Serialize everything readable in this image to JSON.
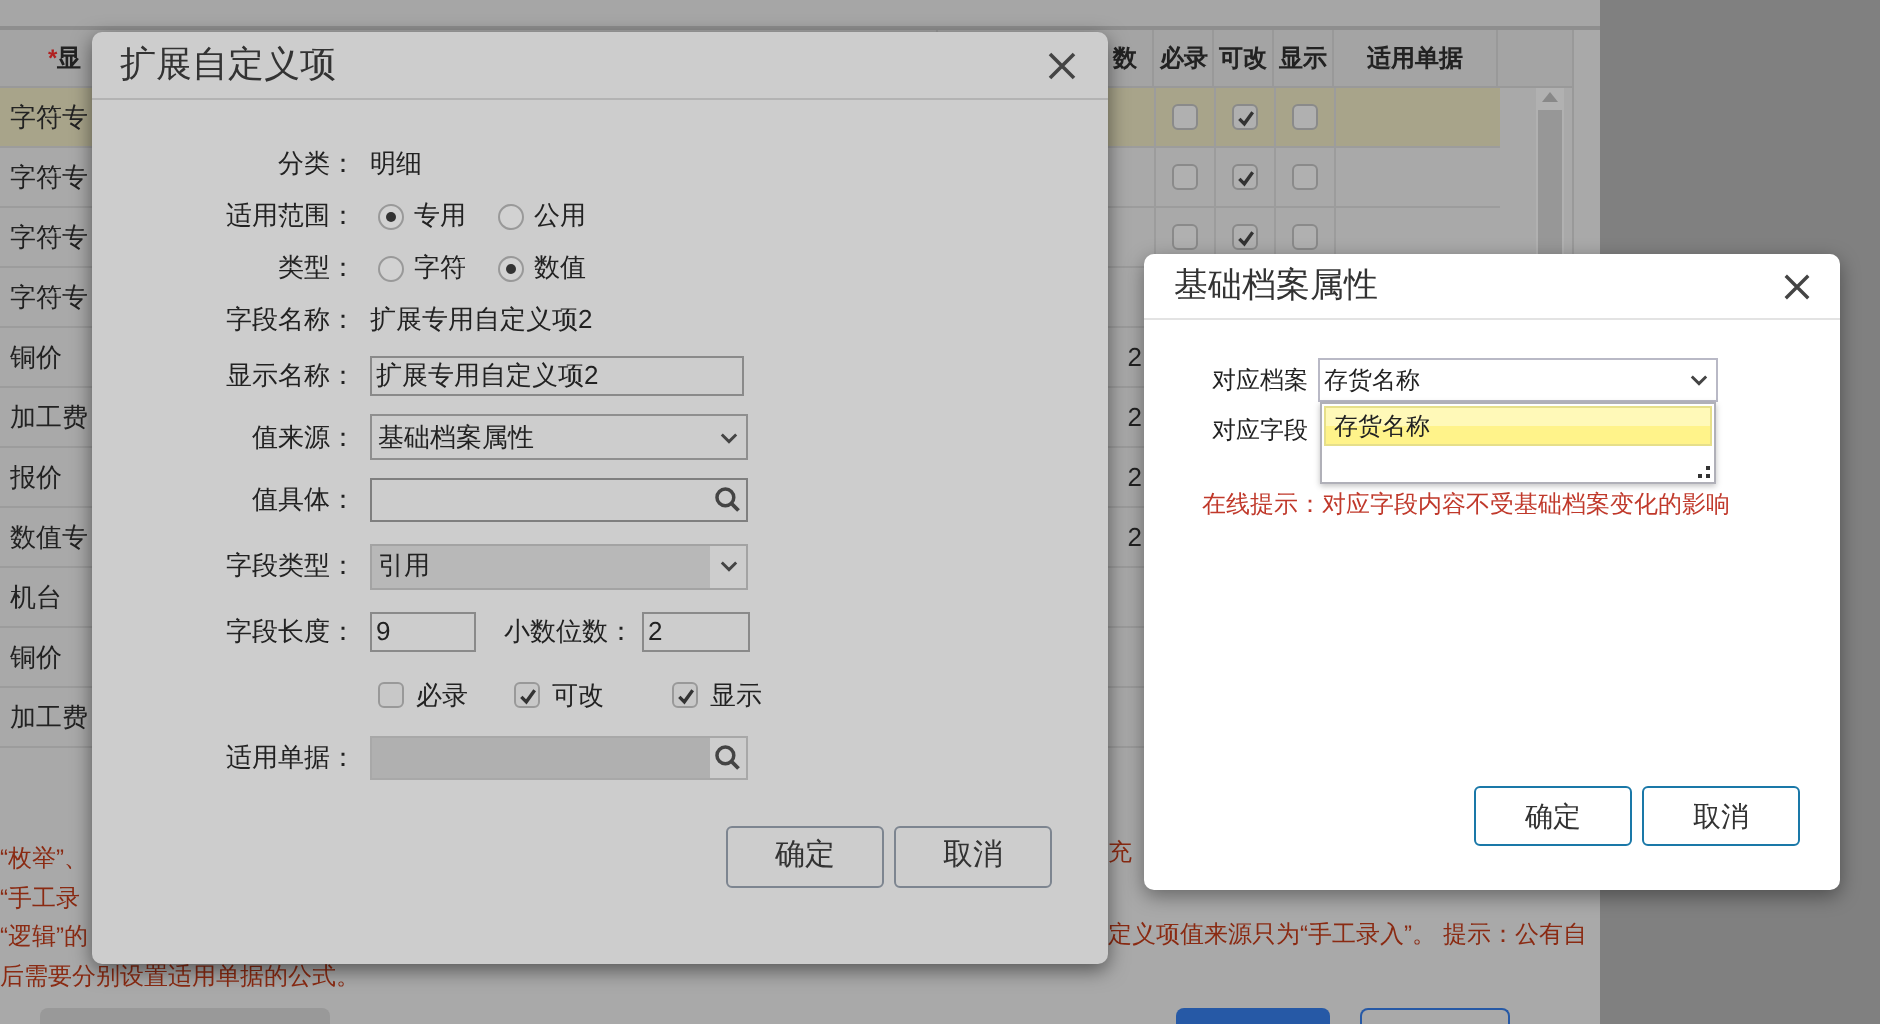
{
  "background_table": {
    "columns": [
      {
        "label": "显",
        "required_mark": "*"
      },
      {
        "label": "数"
      },
      {
        "label": "必录"
      },
      {
        "label": "可改"
      },
      {
        "label": "显示"
      },
      {
        "label": "适用单据"
      }
    ],
    "rows": [
      {
        "label": "字符专",
        "selected": true,
        "required": false,
        "editable": true,
        "visible": false
      },
      {
        "label": "字符专",
        "selected": false,
        "required": false,
        "editable": true,
        "visible": false
      },
      {
        "label": "字符专",
        "selected": false,
        "required": false,
        "editable": true,
        "visible": false
      },
      {
        "label": "字符专",
        "selected": false
      },
      {
        "label": "铜价",
        "selected": false,
        "column_2": "2"
      },
      {
        "label": "加工费",
        "selected": false,
        "column_2": "2"
      },
      {
        "label": "报价",
        "selected": false,
        "column_2": "2"
      },
      {
        "label": "数值专",
        "selected": false,
        "column_2": "2"
      },
      {
        "label": "机台",
        "selected": false
      },
      {
        "label": "铜价",
        "selected": false
      },
      {
        "label": "加工费",
        "selected": false
      }
    ]
  },
  "notes_left": [
    "“枚举”、",
    "“手工录",
    "“逻辑”的",
    "后需要分别设置适用单据的公式。"
  ],
  "notes_right": [
    "充",
    "定义项值来源只为“手工录入”。 提示：公有自"
  ],
  "extend_dialog": {
    "title": "扩展自定义项",
    "fields": [
      {
        "kind": "text",
        "label": "分类：",
        "value": "明细"
      },
      {
        "kind": "radio",
        "label": "适用范围：",
        "options": [
          {
            "label": "专用",
            "selected": true
          },
          {
            "label": "公用",
            "selected": false
          }
        ]
      },
      {
        "kind": "radio",
        "label": "类型：",
        "options": [
          {
            "label": "字符",
            "selected": false
          },
          {
            "label": "数值",
            "selected": true
          }
        ]
      },
      {
        "kind": "text",
        "label": "字段名称：",
        "value": "扩展专用自定义项2"
      },
      {
        "kind": "input",
        "label": "显示名称：",
        "value": "扩展专用自定义项2"
      },
      {
        "kind": "select",
        "label": "值来源：",
        "value": "基础档案属性",
        "disabled": false
      },
      {
        "kind": "lookup",
        "label": "值具体：",
        "disabled": false
      },
      {
        "kind": "select",
        "label": "字段类型：",
        "value": "引用",
        "disabled": true
      },
      {
        "kind": "pair",
        "label": "字段长度：",
        "value": "9",
        "label_2": "小数位数：",
        "value_2": "2"
      },
      {
        "kind": "checks",
        "options": [
          {
            "label": "必录",
            "checked": false
          },
          {
            "label": "可改",
            "checked": true
          },
          {
            "label": "显示",
            "checked": true
          }
        ]
      },
      {
        "kind": "lookup",
        "label": "适用单据：",
        "disabled": true
      }
    ],
    "buttons": [
      "确定",
      "取消"
    ]
  },
  "archive_dialog": {
    "title": "基础档案属性",
    "fields": [
      {
        "label": "对应档案",
        "value": "存货名称"
      },
      {
        "label": "对应字段"
      }
    ],
    "dropdown": {
      "options": [
        {
          "label": "存货名称",
          "selected": true
        }
      ]
    },
    "hint": "在线提示：对应字段内容不受基础档案变化的影响",
    "buttons": [
      "确定",
      "取消"
    ]
  }
}
